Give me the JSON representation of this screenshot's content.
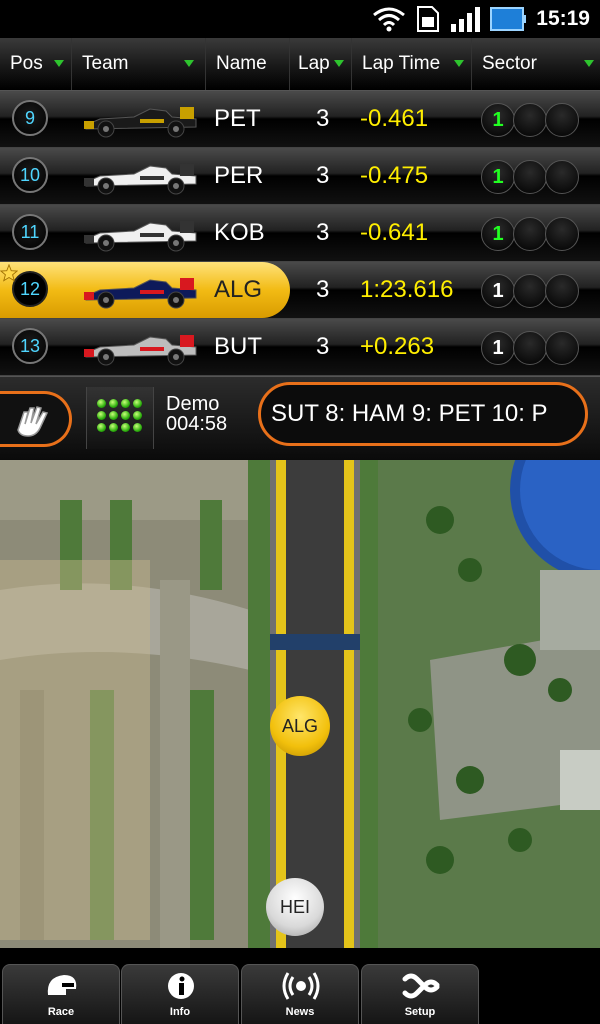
{
  "status": {
    "time": "15:19"
  },
  "columns": [
    "Pos",
    "Team",
    "Name",
    "Lap",
    "Lap Time",
    "Sector"
  ],
  "rows": [
    {
      "pos": "9",
      "name": "PET",
      "lap": "3",
      "time": "-0.461",
      "sector": "1",
      "sector_color": "#22ff22",
      "car_color": "#1a1a1a",
      "car_accent": "#c8a000"
    },
    {
      "pos": "10",
      "name": "PER",
      "lap": "3",
      "time": "-0.475",
      "sector": "1",
      "sector_color": "#22ff22",
      "car_color": "#f0f0f0",
      "car_accent": "#333333"
    },
    {
      "pos": "11",
      "name": "KOB",
      "lap": "3",
      "time": "-0.641",
      "sector": "1",
      "sector_color": "#22ff22",
      "car_color": "#f0f0f0",
      "car_accent": "#333333"
    },
    {
      "pos": "12",
      "name": "ALG",
      "lap": "3",
      "time": "1:23.616",
      "sector": "1",
      "sector_color": "#ffffff",
      "car_color": "#0d1a5a",
      "car_accent": "#d8181f",
      "highlight": true
    },
    {
      "pos": "13",
      "name": "BUT",
      "lap": "3",
      "time": "+0.263",
      "sector": "1",
      "sector_color": "#ffffff",
      "car_color": "#bdbdbd",
      "car_accent": "#d8181f"
    }
  ],
  "control": {
    "demo_label": "Demo",
    "demo_time": "004:58",
    "ticker": "SUT  8: HAM  9: PET  10: P"
  },
  "map": {
    "markers": [
      {
        "label": "ALG",
        "color": "#f2c00c"
      },
      {
        "label": "HEI",
        "color": "#d9d9d9"
      }
    ]
  },
  "nav": [
    "Race",
    "Info",
    "News",
    "Setup"
  ],
  "colors": {
    "accent_orange": "#e8701a",
    "highlight_yellow": "#f2bb14",
    "time_yellow": "#ffee00",
    "pos_cyan": "#4fd6ff"
  }
}
